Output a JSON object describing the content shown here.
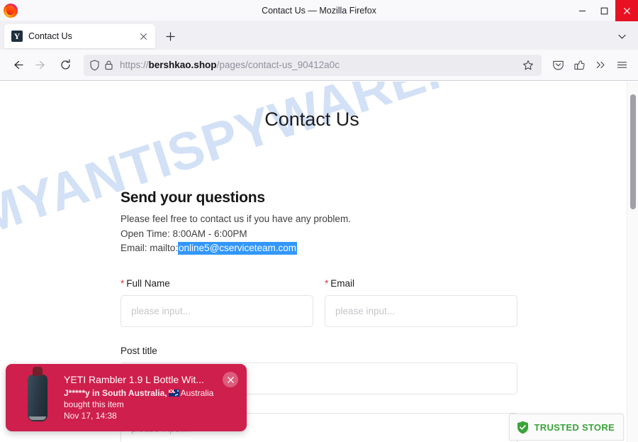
{
  "window": {
    "title": "Contact Us — Mozilla Firefox",
    "minimize_label": "Minimize",
    "maximize_label": "Maximize",
    "close_label": "Close"
  },
  "browser": {
    "tabs": [
      {
        "title": "Contact Us",
        "favicon_letter": "Y",
        "close_label": "Close tab"
      }
    ],
    "new_tab_label": "New tab",
    "list_all_tabs_label": "List all tabs",
    "nav": {
      "back_label": "Go back one page",
      "forward_label": "Go forward one page",
      "reload_label": "Reload current page"
    },
    "urlbar": {
      "scheme": "https://",
      "host": "bershkao.shop",
      "path": "/pages/contact-us_90412a0c",
      "full_url": "https://bershkao.shop/pages/contact-us_90412a0c",
      "shield_label": "Tracking protection",
      "lock_label": "Connection secure",
      "bookmark_label": "Bookmark this page"
    },
    "toolbar": {
      "pocket_label": "Save to Pocket",
      "account_label": "Account",
      "overflow_label": "More tools",
      "menu_label": "Open application menu"
    }
  },
  "page": {
    "watermark": "MYANTISPYWARE.COM",
    "title": "Contact Us",
    "section_heading": "Send your questions",
    "intro": "Please feel free to contact us if you have any problem.",
    "open_time": "Open Time: 8:00AM - 6:00PM",
    "email_prefix": "Email: mailto:",
    "email_selected": "online5@cserviceteam.com",
    "form": {
      "fields": [
        {
          "label": "Full Name",
          "required": true,
          "placeholder": "please input...",
          "value": ""
        },
        {
          "label": "Email",
          "required": true,
          "placeholder": "please input...",
          "value": ""
        }
      ],
      "post_title": {
        "label": "Post title",
        "required": false,
        "placeholder": "",
        "value": ""
      },
      "message": {
        "label": "",
        "required": false,
        "placeholder": "please input...",
        "value": ""
      }
    }
  },
  "toast": {
    "product_title": "YETI Rambler 1.9 L Bottle Wit...",
    "buyer_line": "J*****y in South Australia,",
    "country": "Australia",
    "action_line": "bought this item",
    "timestamp": "Nov 17, 14:38",
    "close_label": "Dismiss notification",
    "background_color": "#cf1f4c"
  },
  "trusted_badge": {
    "label": "TRUSTED STORE",
    "color": "#3aa33a"
  },
  "scrollbar": {
    "vertical_label": "Vertical scrollbar"
  }
}
